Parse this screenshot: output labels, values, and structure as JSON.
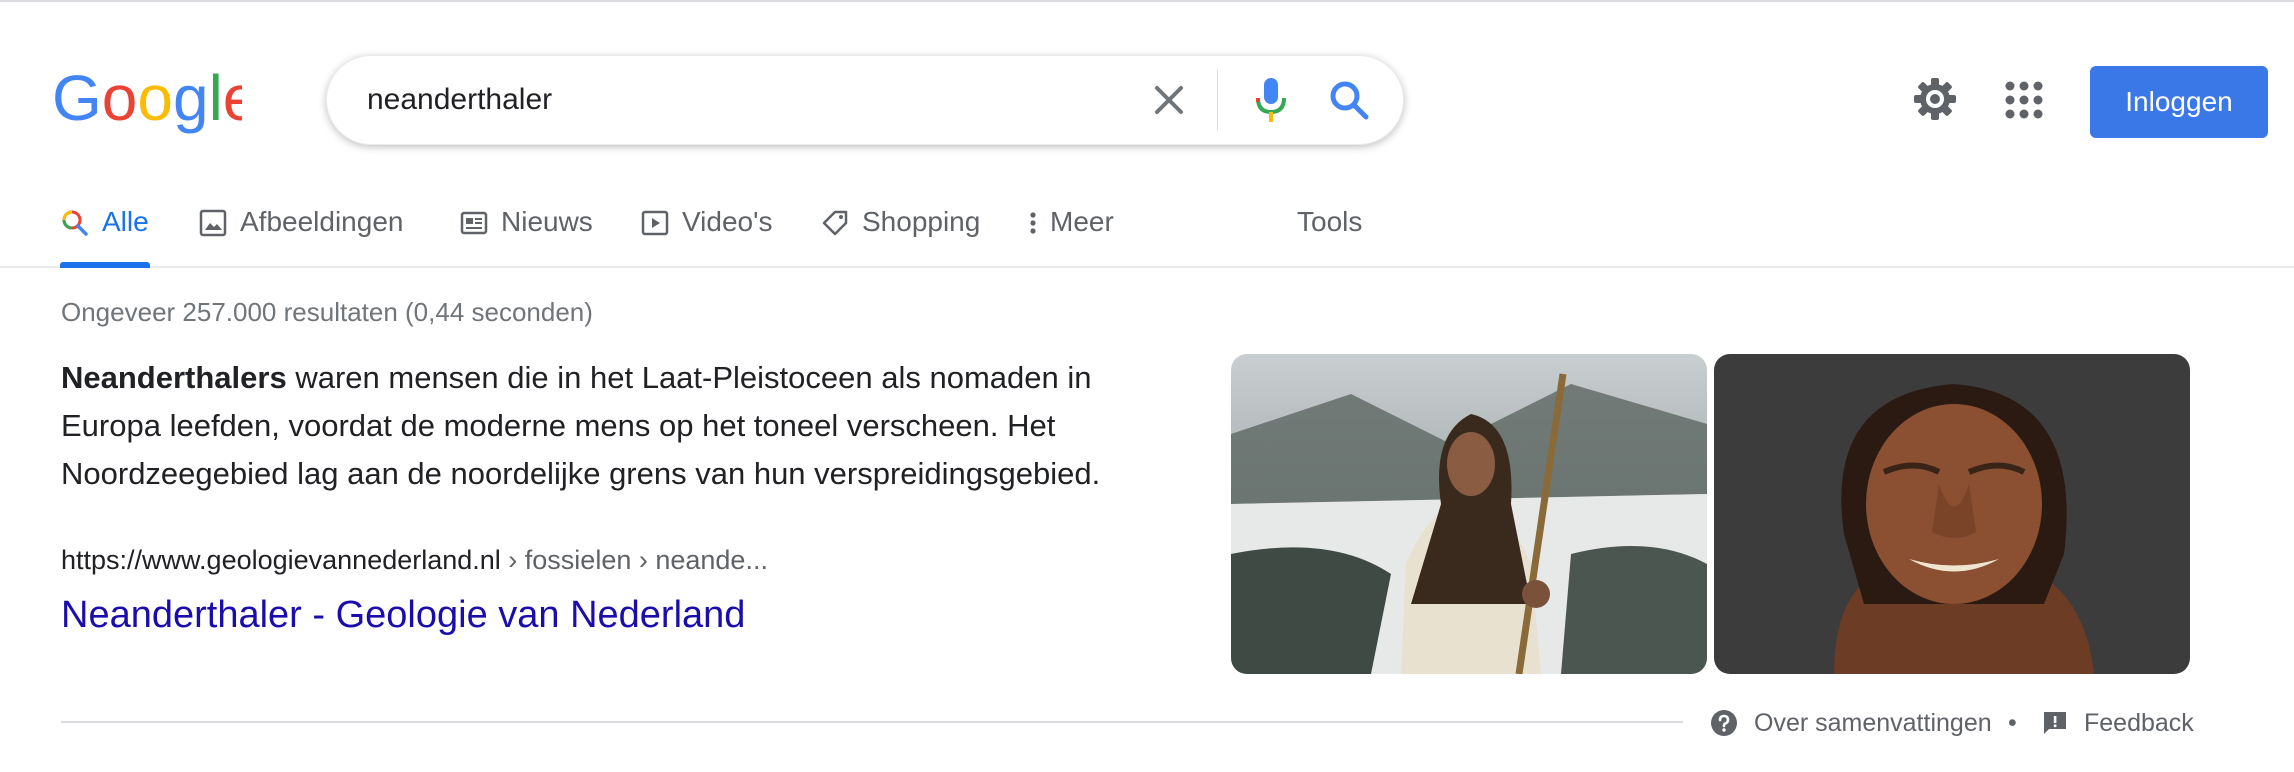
{
  "logo": {
    "text": "Google"
  },
  "search": {
    "query": "neanderthaler"
  },
  "header": {
    "login_label": "Inloggen"
  },
  "tabs": [
    {
      "label": "Alle",
      "icon": "search-icon",
      "active": true
    },
    {
      "label": "Afbeeldingen",
      "icon": "image-icon"
    },
    {
      "label": "Nieuws",
      "icon": "news-icon"
    },
    {
      "label": "Video's",
      "icon": "video-icon"
    },
    {
      "label": "Shopping",
      "icon": "tag-icon"
    },
    {
      "label": "Meer",
      "icon": "more-vert-icon"
    }
  ],
  "tools_label": "Tools",
  "result_stats": "Ongeveer 257.000 resultaten (0,44 seconden)",
  "featured": {
    "snippet_bold": "Neanderthalers",
    "snippet_rest": " waren mensen die in het Laat-Pleistoceen als nomaden in Europa leefden, voordat de moderne mens op het toneel verscheen. Het Noordzeegebied lag aan de noordelijke grens van hun verspreidingsgebied.",
    "cite_domain": "https://www.geologievannederland.nl",
    "cite_path": " › fossielen › neande...",
    "title": "Neanderthaler - Geologie van Nederland"
  },
  "footer": {
    "about_label": "Over samenvattingen",
    "separator": "•",
    "feedback_label": "Feedback"
  },
  "colors": {
    "accent": "#1a73e8",
    "link": "#1a0dab",
    "button": "#3b78e7"
  }
}
